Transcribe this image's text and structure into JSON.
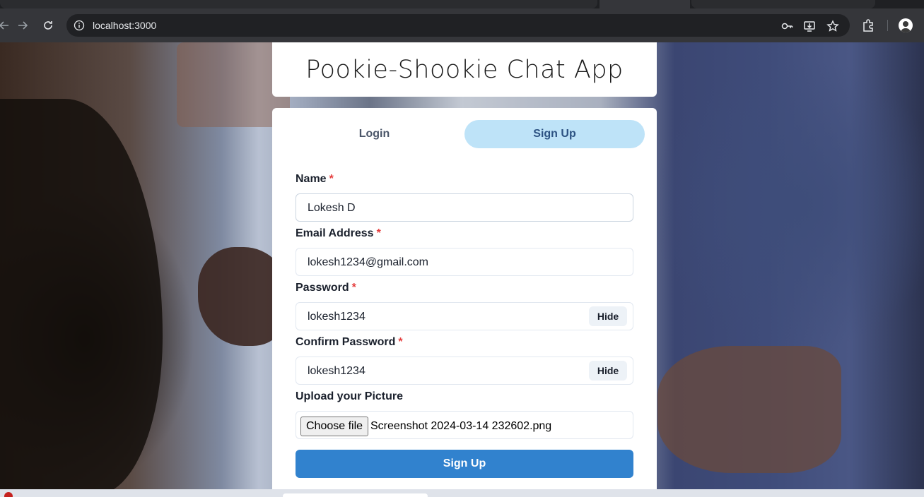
{
  "browser": {
    "url": "localhost:3000"
  },
  "app": {
    "title": "Pookie-Shookie Chat App"
  },
  "tabs": [
    {
      "label": "Login",
      "active": false
    },
    {
      "label": "Sign Up",
      "active": true
    }
  ],
  "form": {
    "name": {
      "label": "Name",
      "required": "*",
      "value": "Lokesh D"
    },
    "email": {
      "label": "Email Address",
      "required": "*",
      "value": "lokesh1234@gmail.com"
    },
    "password": {
      "label": "Password",
      "required": "*",
      "value": "lokesh1234",
      "toggle": "Hide"
    },
    "confirm_password": {
      "label": "Confirm Password",
      "required": "*",
      "value": "lokesh1234",
      "toggle": "Hide"
    },
    "picture": {
      "label": "Upload your Picture",
      "button": "Choose file",
      "file_name": "Screenshot 2024-03-14 232602.png"
    },
    "submit": "Sign Up"
  },
  "colors": {
    "primary": "#3182ce",
    "active_tab_bg": "#bee3f8",
    "active_tab_text": "#2c5282",
    "required": "#e53e3e"
  }
}
